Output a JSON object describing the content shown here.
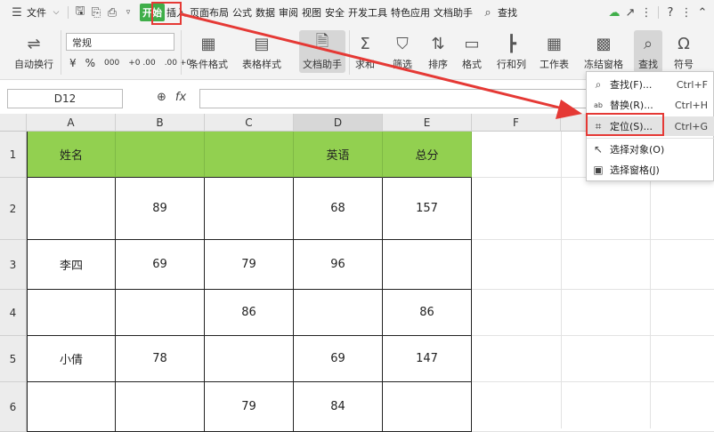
{
  "menubar": {
    "file": "文件",
    "tabs": [
      "开始",
      "插入",
      "页面布局",
      "公式",
      "数据",
      "审阅",
      "视图",
      "安全",
      "开发工具",
      "特色应用",
      "文档助手"
    ],
    "search": "查找"
  },
  "ribbon": {
    "wrap": "自动换行",
    "number_format": "常规",
    "currency": "¥",
    "percent": "%",
    "thousands": "000",
    "dec_inc": "+0 .00",
    "dec_dec": ".00 +0",
    "cond_format": "条件格式",
    "table_style": "表格样式",
    "doc_helper": "文档助手",
    "sum": "求和",
    "filter": "筛选",
    "sort": "排序",
    "format": "格式",
    "rowcol": "行和列",
    "worksheet": "工作表",
    "freeze": "冻结窗格",
    "find": "查找",
    "symbol": "符号"
  },
  "formula_bar": {
    "cell_ref": "D12",
    "fx": "fx",
    "zoom_icon": "⊕"
  },
  "columns": [
    "A",
    "B",
    "C",
    "D",
    "E",
    "F"
  ],
  "rows": [
    "1",
    "2",
    "3",
    "4",
    "5",
    "6"
  ],
  "table": [
    [
      "姓名",
      "",
      "",
      "英语",
      "总分"
    ],
    [
      "",
      "89",
      "",
      "68",
      "157"
    ],
    [
      "李四",
      "69",
      "79",
      "96",
      ""
    ],
    [
      "",
      "",
      "86",
      "",
      "86"
    ],
    [
      "小倩",
      "78",
      "",
      "69",
      "147"
    ],
    [
      "",
      "",
      "79",
      "84",
      ""
    ]
  ],
  "dropdown": {
    "items": [
      {
        "label": "查找(F)...",
        "shortcut": "Ctrl+F"
      },
      {
        "label": "替换(R)...",
        "shortcut": "Ctrl+H"
      },
      {
        "label": "定位(S)...",
        "shortcut": "Ctrl+G"
      },
      {
        "label": "选择对象(O)",
        "shortcut": ""
      },
      {
        "label": "选择窗格(J)",
        "shortcut": ""
      }
    ]
  },
  "colors": {
    "accent": "#3fae49",
    "header_fill": "#92d050",
    "annotation": "#e53935"
  }
}
